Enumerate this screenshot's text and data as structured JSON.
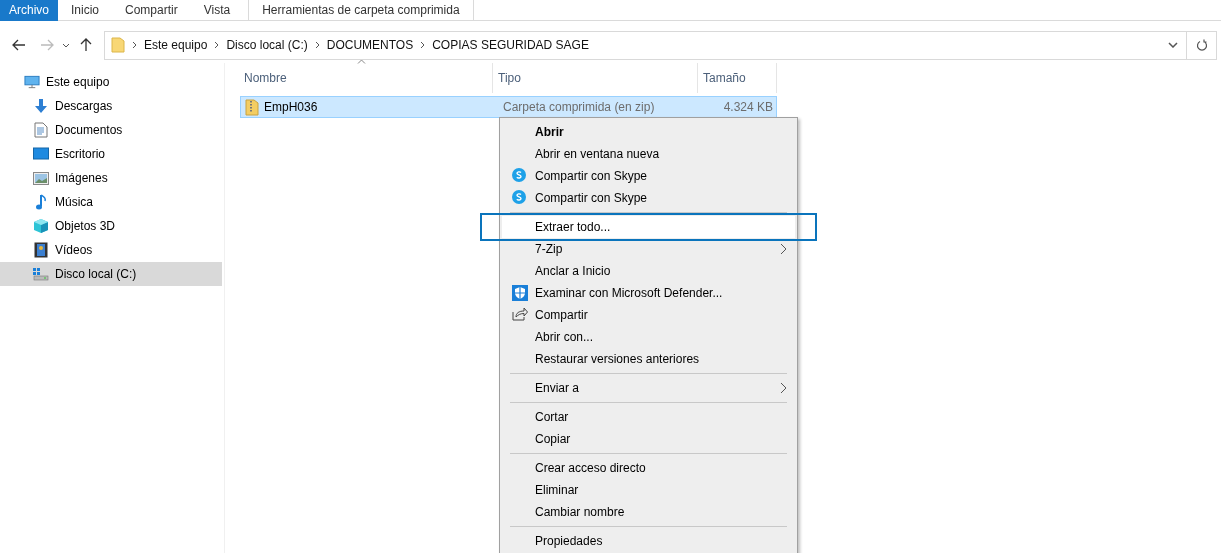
{
  "ribbon_tabs": [
    {
      "label": "Archivo",
      "selected": true
    },
    {
      "label": "Inicio",
      "selected": false
    },
    {
      "label": "Compartir",
      "selected": false
    },
    {
      "label": "Vista",
      "selected": false
    },
    {
      "label": "Herramientas de carpeta comprimida",
      "selected": false
    }
  ],
  "address_bar": {
    "path": [
      "Este equipo",
      "Disco local (C:)",
      "DOCUMENTOS",
      "COPIAS SEGURIDAD SAGE"
    ]
  },
  "navigation_pane": [
    {
      "label": "Este equipo",
      "selected": false,
      "children": [
        {
          "label": "Descargas",
          "selected": false
        },
        {
          "label": "Documentos",
          "selected": false
        },
        {
          "label": "Escritorio",
          "selected": false
        },
        {
          "label": "Imágenes",
          "selected": false
        },
        {
          "label": "Música",
          "selected": false
        },
        {
          "label": "Objetos 3D",
          "selected": false
        },
        {
          "label": "Vídeos",
          "selected": false
        },
        {
          "label": "Disco local (C:)",
          "selected": true
        }
      ]
    }
  ],
  "file_list": {
    "columns": [
      "Nombre",
      "Tipo",
      "Tamaño"
    ],
    "rows": [
      {
        "name": "EmpH036",
        "type": "Carpeta comprimida (en zip)",
        "size": "4.324 KB",
        "selected": true
      }
    ]
  },
  "context_menu": [
    {
      "kind": "item",
      "label": "Abrir",
      "default": true
    },
    {
      "kind": "item",
      "label": "Abrir en ventana nueva"
    },
    {
      "kind": "skype",
      "label": "Compartir con Skype"
    },
    {
      "kind": "skype",
      "label": "Compartir con Skype"
    },
    {
      "kind": "separator"
    },
    {
      "kind": "item",
      "label": "Extraer todo...",
      "highlighted": true
    },
    {
      "kind": "item",
      "label": "7-Zip",
      "submenu": true
    },
    {
      "kind": "item",
      "label": "Anclar a Inicio"
    },
    {
      "kind": "shield",
      "label": "Examinar con Microsoft Defender..."
    },
    {
      "kind": "share",
      "label": "Compartir"
    },
    {
      "kind": "item",
      "label": "Abrir con..."
    },
    {
      "kind": "item",
      "label": "Restaurar versiones anteriores"
    },
    {
      "kind": "separator"
    },
    {
      "kind": "item",
      "label": "Enviar a",
      "submenu": true
    },
    {
      "kind": "separator"
    },
    {
      "kind": "item",
      "label": "Cortar"
    },
    {
      "kind": "item",
      "label": "Copiar"
    },
    {
      "kind": "separator"
    },
    {
      "kind": "item",
      "label": "Crear acceso directo"
    },
    {
      "kind": "item",
      "label": "Eliminar"
    },
    {
      "kind": "item",
      "label": "Cambiar nombre"
    },
    {
      "kind": "separator"
    },
    {
      "kind": "item",
      "label": "Propiedades"
    }
  ]
}
